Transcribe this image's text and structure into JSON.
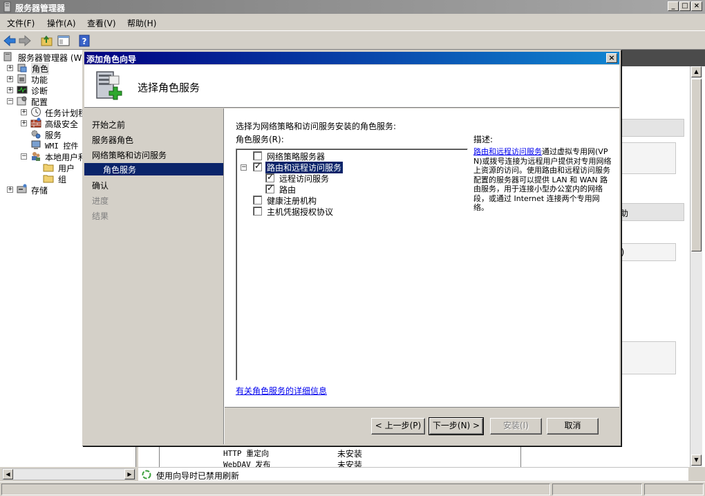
{
  "window": {
    "title": "服务器管理器"
  },
  "menu": {
    "file": "文件(F)",
    "action": "操作(A)",
    "view": "查看(V)",
    "help": "帮助(H)"
  },
  "tree": {
    "root": "服务器管理器 (W:",
    "roles": "角色",
    "features": "功能",
    "diagnostics": "诊断",
    "config": "配置",
    "task_scheduler": "任务计划程",
    "advanced_security": "高级安全",
    "services": "服务",
    "wmi": "WMI 控件",
    "local_users": "本地用户和",
    "users": "用户",
    "groups": "组",
    "storage": "存储"
  },
  "background": {
    "peek_right_1": "助",
    "peek_right_2": "S)",
    "row1_name": "HTTP 重定向",
    "row1_status": "未安装",
    "row2_name": "WebDAV 发布",
    "row2_status": "未安装",
    "refresh_notice": "使用向导时已禁用刷新"
  },
  "wizard": {
    "title": "添加角色向导",
    "header": "选择角色服务",
    "nav": {
      "before_you_begin": "开始之前",
      "server_roles": "服务器角色",
      "npas": "网络策略和访问服务",
      "role_services": "角色服务",
      "confirmation": "确认",
      "progress": "进度",
      "results": "结果"
    },
    "intro": "选择为网络策略和访问服务安装的角色服务:",
    "list_label": "角色服务(R):",
    "services": [
      {
        "label": "网络策略服务器",
        "checked": false
      },
      {
        "label": "路由和远程访问服务",
        "checked": true
      },
      {
        "label": "远程访问服务",
        "checked": true
      },
      {
        "label": "路由",
        "checked": true
      },
      {
        "label": "健康注册机构",
        "checked": false
      },
      {
        "label": "主机凭据授权协议",
        "checked": false
      }
    ],
    "desc_label": "描述:",
    "desc_link": "路由和远程访问服务",
    "desc_text": "通过虚拟专用网(VPN)或拨号连接为远程用户提供对专用网络上资源的访问。使用路由和远程访问服务配置的服务器可以提供 LAN 和 WAN 路由服务，用于连接小型办公室内的网络段，或通过 Internet 连接两个专用网络。",
    "more_info_link": "有关角色服务的详细信息",
    "buttons": {
      "back": "< 上一步(P)",
      "next": "下一步(N) >",
      "install": "安装(I)",
      "cancel": "取消"
    }
  }
}
